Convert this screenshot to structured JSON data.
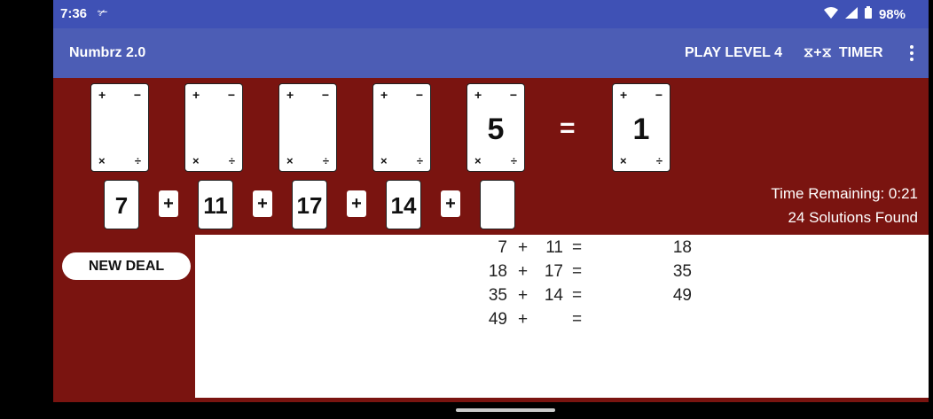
{
  "status": {
    "time": "7:36",
    "notif": "✃",
    "battery": "98%"
  },
  "appbar": {
    "title": "Numbrz 2.0",
    "play": "PLAY LEVEL 4",
    "timer": "TIMER",
    "timer_icon": "⧖+⧖",
    "menu": "⋮"
  },
  "cards": {
    "ops": {
      "plus": "+",
      "minus": "−",
      "times": "×",
      "divide": "÷"
    },
    "values": [
      "",
      "",
      "",
      "",
      "5"
    ],
    "equals": "=",
    "target": "1"
  },
  "tiles": [
    "7",
    "11",
    "17",
    "14",
    ""
  ],
  "op_buttons": [
    "+",
    "+",
    "+",
    "+"
  ],
  "info": {
    "time_remaining": "Time Remaining: 0:21",
    "solutions": "24 Solutions Found"
  },
  "new_deal": "NEW DEAL",
  "work": [
    {
      "a": "7",
      "op": "+",
      "b": "11",
      "eq": "=",
      "r": "18"
    },
    {
      "a": "18",
      "op": "+",
      "b": "17",
      "eq": "=",
      "r": "35"
    },
    {
      "a": "35",
      "op": "+",
      "b": "14",
      "eq": "=",
      "r": "49"
    },
    {
      "a": "49",
      "op": "+",
      "b": "",
      "eq": "=",
      "r": ""
    }
  ]
}
